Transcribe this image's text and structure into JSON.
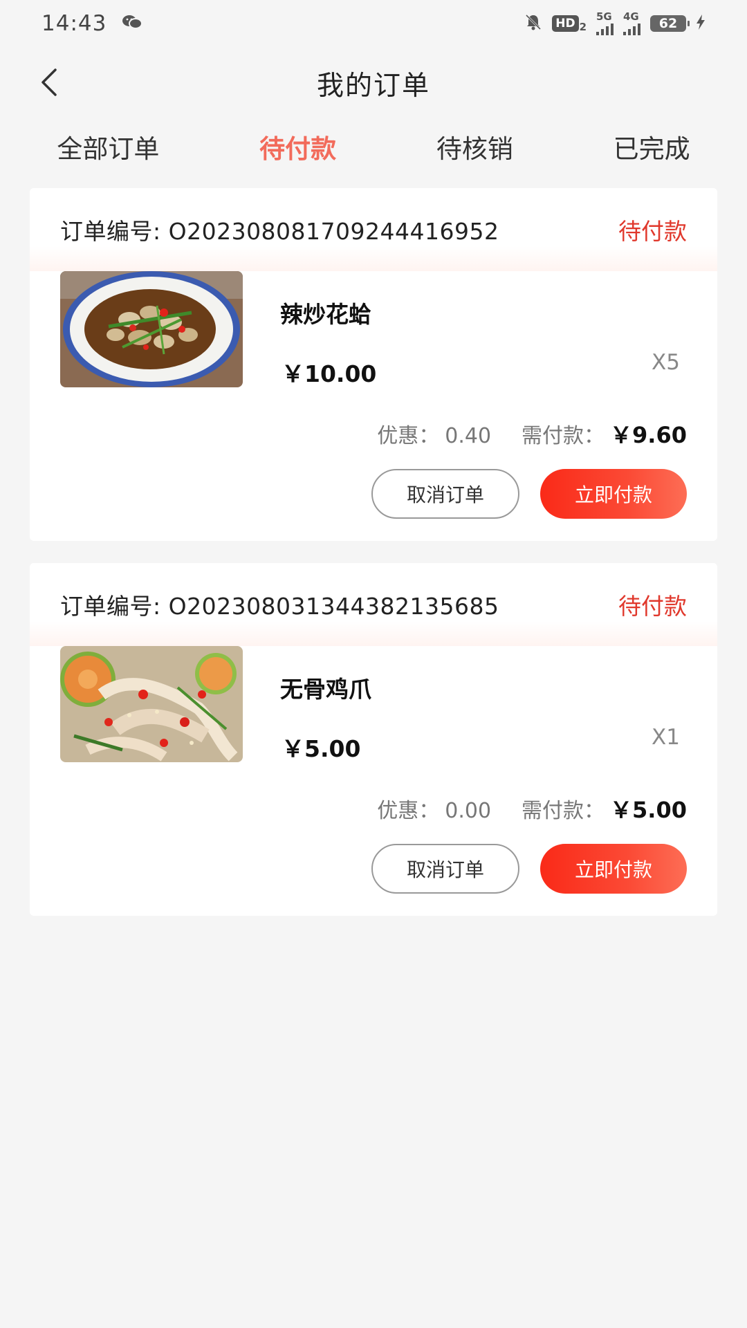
{
  "status_bar": {
    "time": "14:43",
    "icons": [
      "wechat-icon",
      "mute-bell-icon",
      "hd-icon",
      "5g-signal-icon",
      "4g-signal-icon",
      "battery-icon",
      "charging-icon"
    ],
    "hd_label": "HD",
    "hd_sub": "2",
    "net1": "5G",
    "net2": "4G",
    "battery": "62"
  },
  "header": {
    "title": "我的订单"
  },
  "tabs": [
    {
      "label": "全部订单",
      "active": false
    },
    {
      "label": "待付款",
      "active": true
    },
    {
      "label": "待核销",
      "active": false
    },
    {
      "label": "已完成",
      "active": false
    }
  ],
  "colors": {
    "accent": "#f26b5b",
    "status_red": "#e0382c",
    "pay_button": "#fa2a18"
  },
  "orders": [
    {
      "order_no_label": "订单编号: O20230808170924441695​2",
      "status": "待付款",
      "item_name": "辣炒花蛤",
      "price": "￥10.00",
      "qty": "X5",
      "discount_label": "优惠：",
      "discount": "0.40",
      "pay_label": "需付款：",
      "pay_amount": "￥9.60",
      "cancel_label": "取消订单",
      "pay_button_label": "立即付款",
      "image": "clams-dish"
    },
    {
      "order_no_label": "订单编号: O20230803134438213568​5",
      "status": "待付款",
      "item_name": "无骨鸡爪",
      "price": "￥5.00",
      "qty": "X1",
      "discount_label": "优惠：",
      "discount": "0.00",
      "pay_label": "需付款：",
      "pay_amount": "￥5.00",
      "cancel_label": "取消订单",
      "pay_button_label": "立即付款",
      "image": "chicken-feet-dish"
    }
  ]
}
